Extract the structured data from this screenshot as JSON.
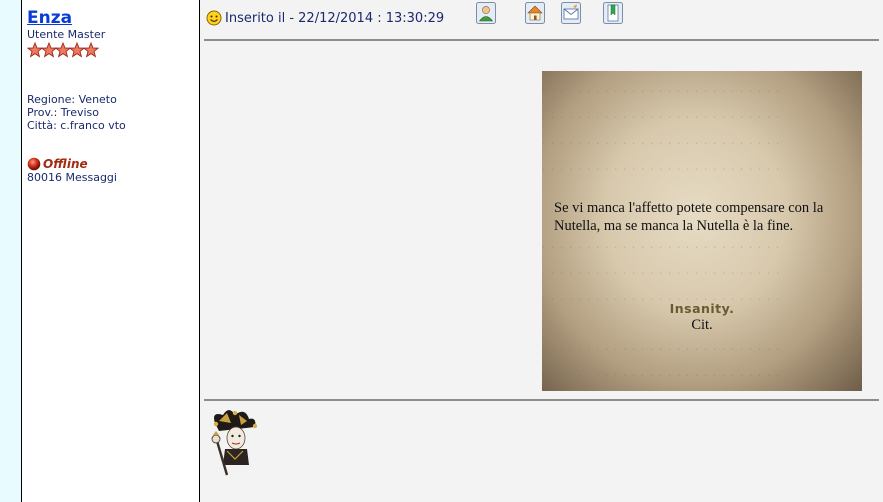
{
  "user": {
    "name": "Enza",
    "rank": "Utente Master",
    "star_count": 5,
    "region": "Regione: Veneto",
    "province": "Prov.: Treviso",
    "city": "Città: c.franco vto",
    "status": "Offline",
    "messages": "80016 Messaggi"
  },
  "post": {
    "posted_label": "Inserito il - 22/12/2014 : 13:30:29",
    "actions": [
      "profile-icon",
      "home-icon",
      "email-icon",
      "bookmark-icon"
    ]
  },
  "image": {
    "quote": "Se vi manca l'affetto potete compensare con la Nutella, ma se manca la Nutella è la fine.",
    "brand": "Insanity.",
    "cit": "Cit."
  },
  "colors": {
    "link": "#0a3cd8",
    "text": "#1a2a6c",
    "offline": "#a42a12",
    "strip": "#e8fbff"
  }
}
